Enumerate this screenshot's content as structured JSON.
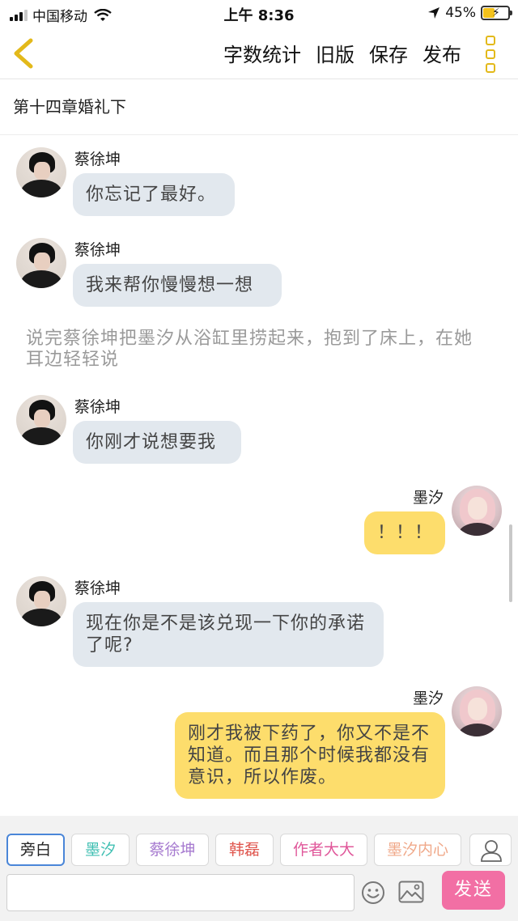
{
  "status_bar": {
    "carrier": "中国移动",
    "time": "上午 8:36",
    "battery_percent": "45%",
    "battery_level": 0.45
  },
  "nav": {
    "back_icon": "chevron-left-icon",
    "actions": [
      "字数统计",
      "旧版",
      "保存",
      "发布"
    ],
    "more_icon": "more-vertical-icon",
    "accent_color": "#e3b91a"
  },
  "chapter_title": "第十四章婚礼下",
  "messages": [
    {
      "side": "left",
      "sender": "蔡徐坤",
      "text": "你忘记了最好。"
    },
    {
      "side": "left",
      "sender": "蔡徐坤",
      "text": "我来帮你慢慢想一想"
    },
    {
      "type": "narration",
      "text": "说完蔡徐坤把墨汐从浴缸里捞起来，抱到了床上，在她耳边轻轻说"
    },
    {
      "side": "left",
      "sender": "蔡徐坤",
      "text": "你刚才说想要我"
    },
    {
      "side": "right",
      "sender": "墨汐",
      "text": "！！！"
    },
    {
      "side": "left",
      "sender": "蔡徐坤",
      "text": "现在你是不是该兑现一下你的承诺了呢?"
    },
    {
      "side": "right",
      "sender": "墨汐",
      "text": "刚才我被下药了，你又不是不知道。而且那个时候我都没有意识，所以作废。"
    }
  ],
  "role_tabs": [
    {
      "label": "旁白",
      "color": "#222222",
      "active": true
    },
    {
      "label": "墨汐",
      "color": "#3fbfb2",
      "active": false
    },
    {
      "label": "蔡徐坤",
      "color": "#a77bd0",
      "active": false
    },
    {
      "label": "韩磊",
      "color": "#e0574f",
      "active": false
    },
    {
      "label": "作者大大",
      "color": "#e0579a",
      "active": false
    },
    {
      "label": "墨汐内心",
      "color": "#f0a98a",
      "active": false
    }
  ],
  "role_user_icon": "user-icon",
  "composer": {
    "value": "",
    "placeholder": "",
    "emoji_icon": "emoji-icon",
    "image_icon": "image-icon",
    "send_label": "发送",
    "send_color": "#f26fa4"
  },
  "colors": {
    "left_bubble": "#e2e8ee",
    "right_bubble": "#fddd6c"
  }
}
